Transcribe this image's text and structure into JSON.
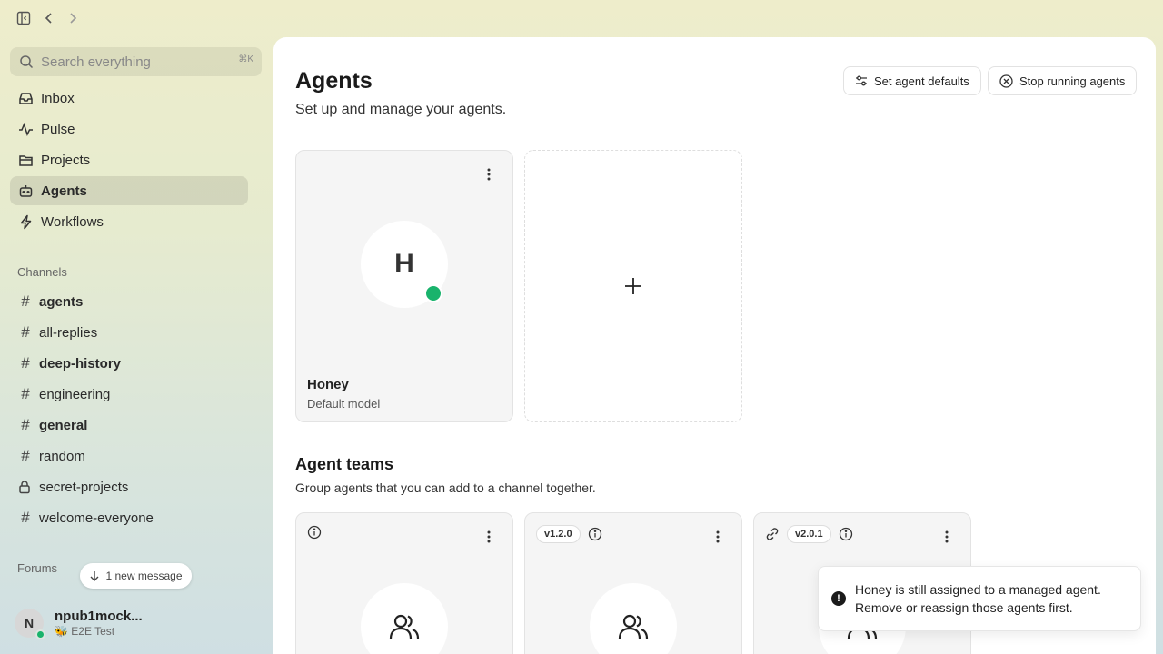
{
  "window": {
    "toolbar_icons": [
      "sidebar-toggle-icon",
      "back-icon",
      "forward-icon"
    ]
  },
  "search": {
    "placeholder": "Search everything",
    "shortcut": "⌘K"
  },
  "nav": [
    {
      "label": "Inbox",
      "icon": "inbox-icon"
    },
    {
      "label": "Pulse",
      "icon": "pulse-icon"
    },
    {
      "label": "Projects",
      "icon": "folder-icon"
    },
    {
      "label": "Agents",
      "icon": "bot-icon",
      "active": true
    },
    {
      "label": "Workflows",
      "icon": "bolt-icon"
    }
  ],
  "channels": {
    "label": "Channels",
    "items": [
      {
        "name": "agents",
        "bold": true,
        "icon": "hash"
      },
      {
        "name": "all-replies",
        "bold": false,
        "icon": "hash"
      },
      {
        "name": "deep-history",
        "bold": true,
        "icon": "hash"
      },
      {
        "name": "engineering",
        "bold": false,
        "icon": "hash"
      },
      {
        "name": "general",
        "bold": true,
        "icon": "hash"
      },
      {
        "name": "random",
        "bold": false,
        "icon": "hash"
      },
      {
        "name": "secret-projects",
        "bold": false,
        "icon": "lock"
      },
      {
        "name": "welcome-everyone",
        "bold": false,
        "icon": "hash"
      }
    ]
  },
  "forums": {
    "label": "Forums"
  },
  "new_message": {
    "label": "1 new message"
  },
  "user": {
    "initial": "N",
    "name": "npub1mock...",
    "org": "🐝 E2E Test"
  },
  "page": {
    "title": "Agents",
    "subtitle": "Set up and manage your agents.",
    "buttons": {
      "defaults": "Set agent defaults",
      "stop": "Stop running agents"
    }
  },
  "agents": [
    {
      "initial": "H",
      "name": "Honey",
      "model": "Default model",
      "status": "online"
    }
  ],
  "teams_section": {
    "title": "Agent teams",
    "subtitle": "Group agents that you can add to a channel together.",
    "teams": [
      {
        "version": "",
        "has_link": false
      },
      {
        "version": "v1.2.0",
        "has_link": false
      },
      {
        "version": "v2.0.1",
        "has_link": true
      }
    ]
  },
  "toast": {
    "line1": "Honey is still assigned to a managed agent.",
    "line2": "Remove or reassign those agents first."
  },
  "colors": {
    "online": "#19b36c",
    "active_nav_bg": "#00000017"
  }
}
